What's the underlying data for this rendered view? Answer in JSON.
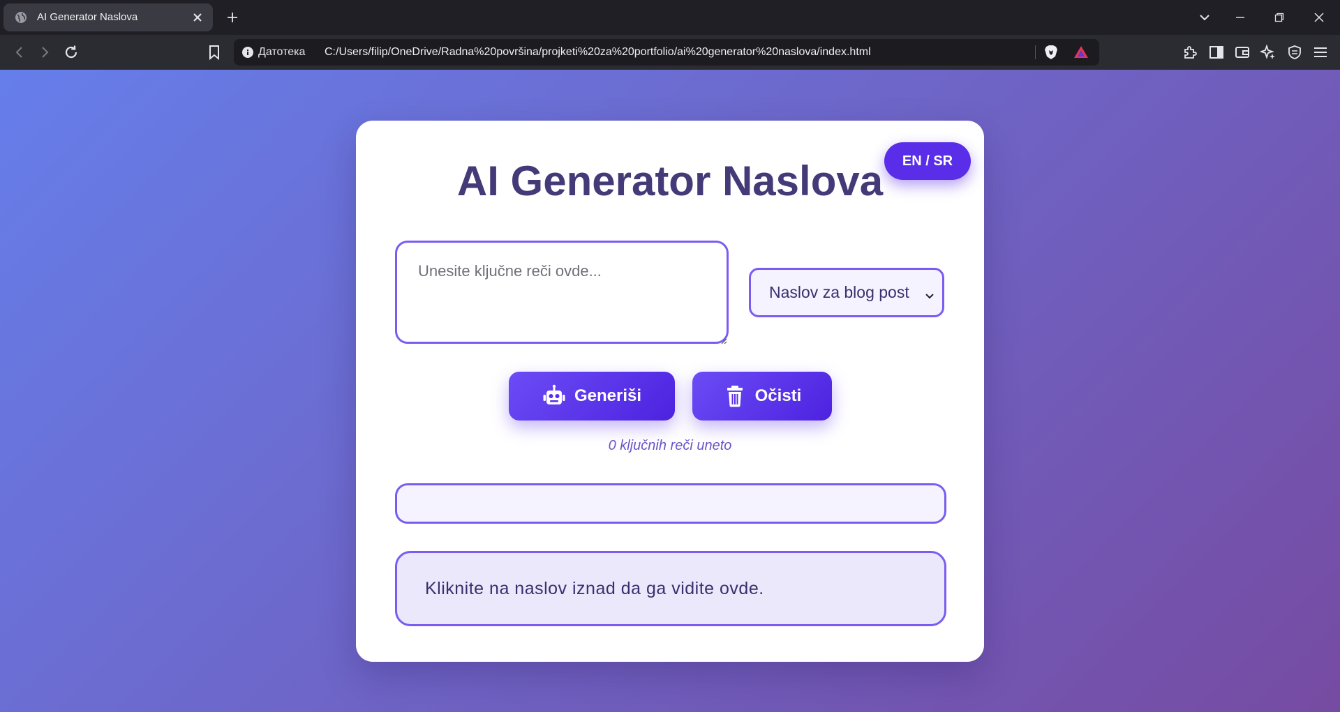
{
  "browser": {
    "tab": {
      "title": "AI Generator Naslova",
      "favicon": "globe-icon"
    },
    "address": {
      "scheme_label": "Датотека",
      "url": "C:/Users/filip/OneDrive/Radna%20površina/projketi%20za%20portfolio/ai%20generator%20naslova/index.html"
    },
    "icons": [
      "back-icon",
      "forward-icon",
      "reload-icon",
      "bookmark-icon",
      "info-icon",
      "brave-shield-icon",
      "brave-rewards-icon",
      "extensions-icon",
      "sidebar-icon",
      "wallet-icon",
      "leo-ai-icon",
      "vpn-icon",
      "menu-icon"
    ]
  },
  "app": {
    "lang_toggle": "EN / SR",
    "title": "AI Generator Naslova",
    "keywords_placeholder": "Unesite ključne reči ovde...",
    "type_select": {
      "selected": "Naslov za blog post"
    },
    "buttons": {
      "generate": "Generiši",
      "clear": "Očisti"
    },
    "keyword_count": "0 ključnih reči uneto",
    "preview_text": "Kliknite na naslov iznad da ga vidite ovde."
  },
  "colors": {
    "gradient_start": "#667eea",
    "gradient_end": "#764ba2",
    "accent": "#5a2de8",
    "title": "#443a78"
  }
}
